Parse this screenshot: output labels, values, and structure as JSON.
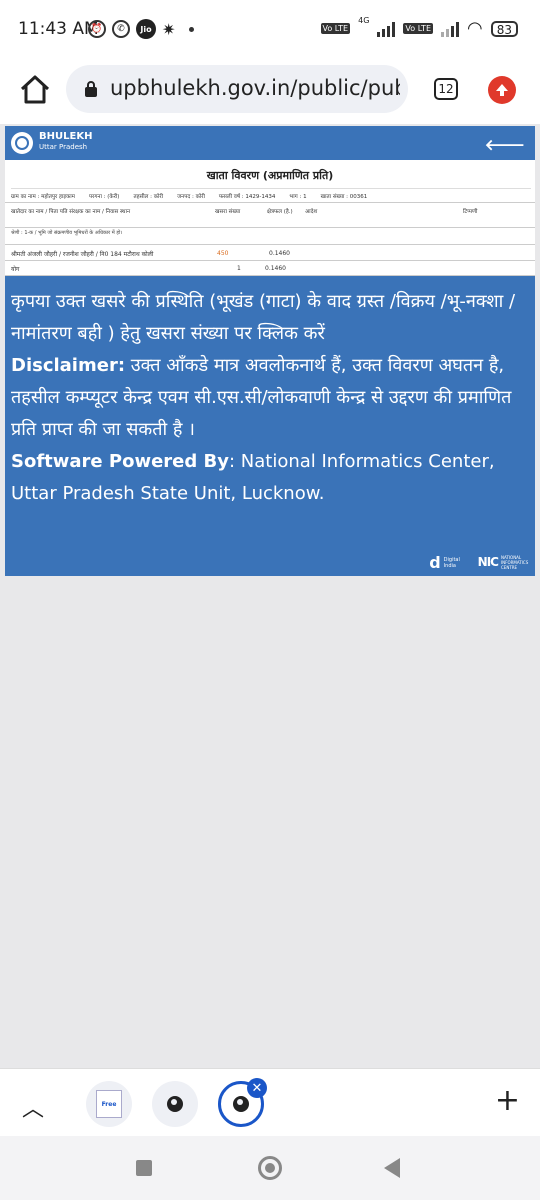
{
  "status_bar": {
    "time": "11:43 AM",
    "network": "4G",
    "lte1": "Vo LTE",
    "lte2": "Vo LTE",
    "battery": "83",
    "jio": "Jio"
  },
  "browser": {
    "url": "upbhulekh.gov.in/public/publ",
    "tab_count": "12"
  },
  "portal": {
    "brand": "BHULEKH",
    "brand_sub": "Uttar Pradesh",
    "doc_title": "खाता विवरण (अप्रमाणित प्रति)",
    "meta": [
      "ग्राम का नाम : महोतपुर हाइकाम",
      "परगना : (केरी)",
      "तहसील : कोरी",
      "जनपद : कोरी",
      "फसली वर्ष : 1429-1434",
      "भाग : 1",
      "खाता संख्या : 00361"
    ],
    "columns": [
      "खातेदार का नाम / पिता पति संरक्षक का नाम / निवास स्थान",
      "खसरा संख्या",
      "क्षेत्रफल (है.)",
      "आदेश",
      "टिप्पणी"
    ],
    "category": "श्रेणी : 1-क / भूमि जो संक्रमणीय भूमिधरों के अधिकार में हो।",
    "row": {
      "owner": "श्रीमती अंजली जौहरी / रजनीश जौहरी / नि0 184 मटौराथ कोली",
      "khasra": "450",
      "area": "0.1460"
    },
    "total": {
      "label": "योग",
      "count": "1",
      "area": "0.1460"
    }
  },
  "notice": {
    "line1": "कृपया उक्त खसरे की प्रस्थिति (भूखंड (गाटा) के वाद ग्रस्त /विक्रय /भू-नक्शा / नामांतरण बही ) हेतु खसरा संख्या पर क्लिक करें",
    "disclaimer_label": "Disclaimer:",
    "disclaimer_text": " उक्त आँकडे मात्र अवलोकनार्थ हैं, उक्त विवरण अघतन है, तहसील कम्प्यूटर केन्द्र एवम सी.एस.सी/लोकवाणी केन्द्र से उद्दरण की प्रमाणित प्रति प्राप्त की जा सकती है ।",
    "powered_label": "Software Powered By",
    "powered_text": ": National Informatics Center, Uttar Pradesh State Unit, Lucknow."
  },
  "footer": {
    "digital_india": "Digital India",
    "nic": "NIC",
    "nic_sub": "NATIONAL INFORMATICS CENTRE"
  },
  "toolbar": {
    "thumb1": "Free"
  }
}
